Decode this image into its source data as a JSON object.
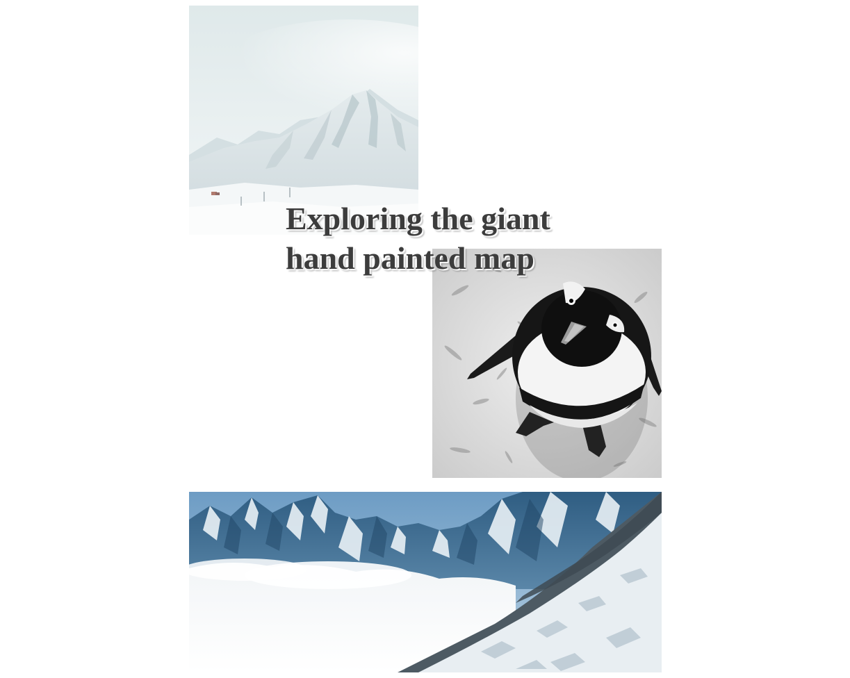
{
  "article": {
    "title": "Exploring the giant hand painted map"
  },
  "images": [
    {
      "name": "snowy-mountain-photo",
      "subject": "hazy snow-covered mountain peak with ski lift"
    },
    {
      "name": "penguin-photo",
      "subject": "black and white penguin viewed from above on snow"
    },
    {
      "name": "alpine-glacier-photo",
      "subject": "alpine peaks above clouds with glacier in foreground"
    }
  ]
}
